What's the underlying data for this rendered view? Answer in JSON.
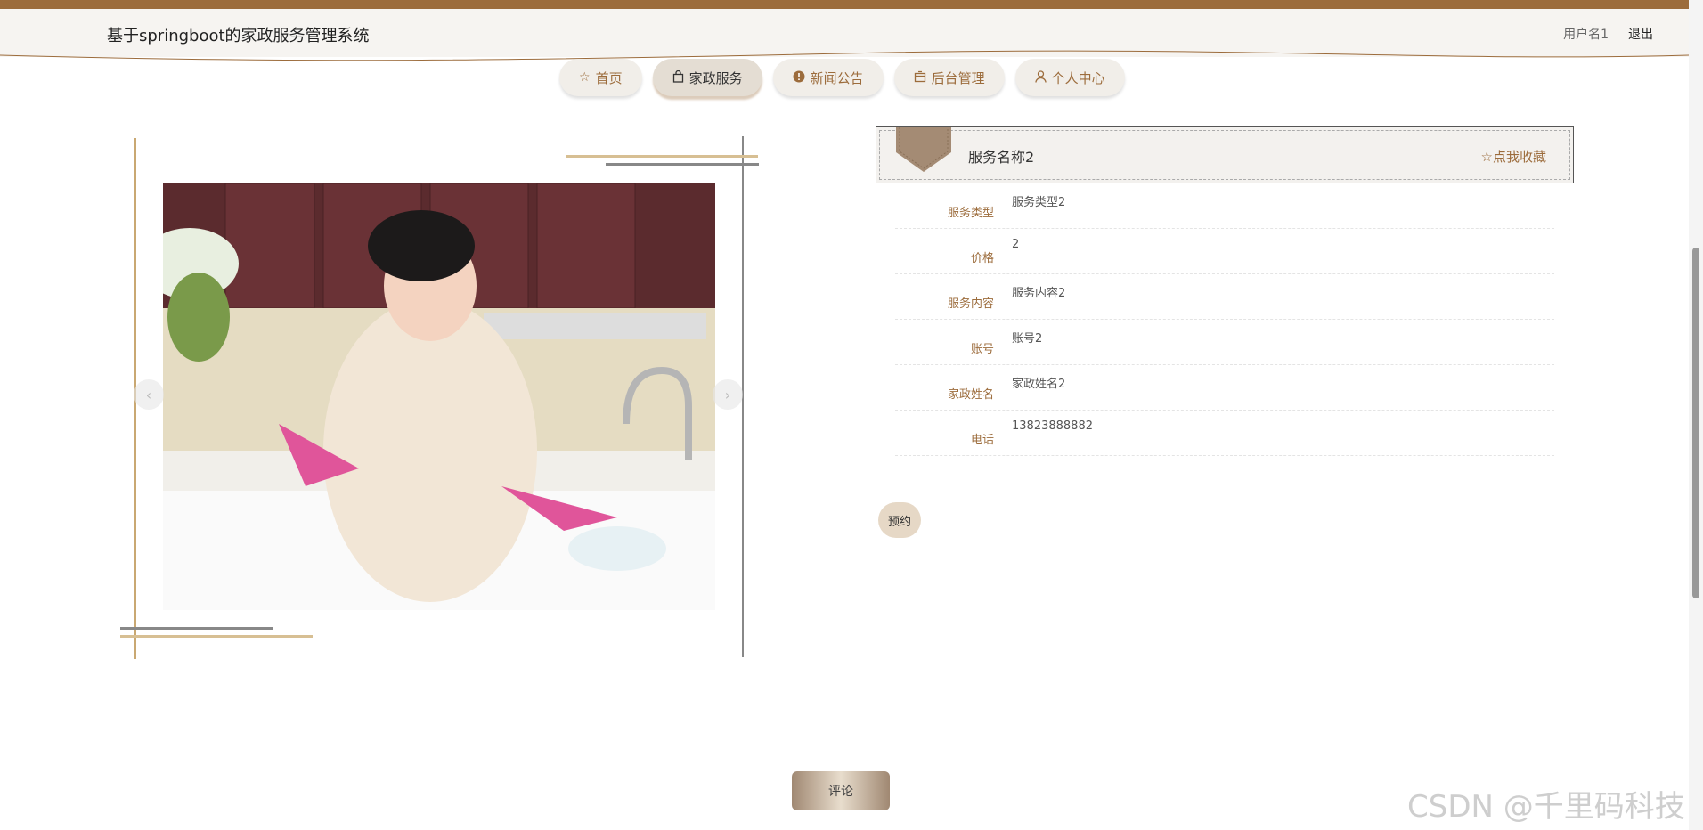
{
  "header": {
    "site_title": "基于springboot的家政服务管理系统",
    "username": "用户名1",
    "logout_label": "退出"
  },
  "nav": {
    "items": [
      {
        "label": "首页",
        "icon": "star-icon"
      },
      {
        "label": "家政服务",
        "icon": "bag-icon"
      },
      {
        "label": "新闻公告",
        "icon": "alert-icon"
      },
      {
        "label": "后台管理",
        "icon": "box-icon"
      },
      {
        "label": "个人中心",
        "icon": "user-icon"
      }
    ],
    "active": "家政服务"
  },
  "gallery": {
    "prev": "‹",
    "next": "›"
  },
  "detail": {
    "name": "服务名称2",
    "favorite_label": "☆点我收藏",
    "fields": [
      {
        "label": "服务类型",
        "value": "服务类型2"
      },
      {
        "label": "价格",
        "value": "2"
      },
      {
        "label": "服务内容",
        "value": "服务内容2"
      },
      {
        "label": "账号",
        "value": "账号2"
      },
      {
        "label": "家政姓名",
        "value": "家政姓名2"
      },
      {
        "label": "电话",
        "value": "13823888882"
      }
    ],
    "book_label": "预约"
  },
  "comment_label": "评论",
  "watermark": "CSDN @千里码科技",
  "colors": {
    "brand_brown": "#9c6c3c",
    "header_bg": "#f6f4f1",
    "nav_active_bg": "#e4ddd3",
    "book_bg": "#e6d8c6"
  }
}
